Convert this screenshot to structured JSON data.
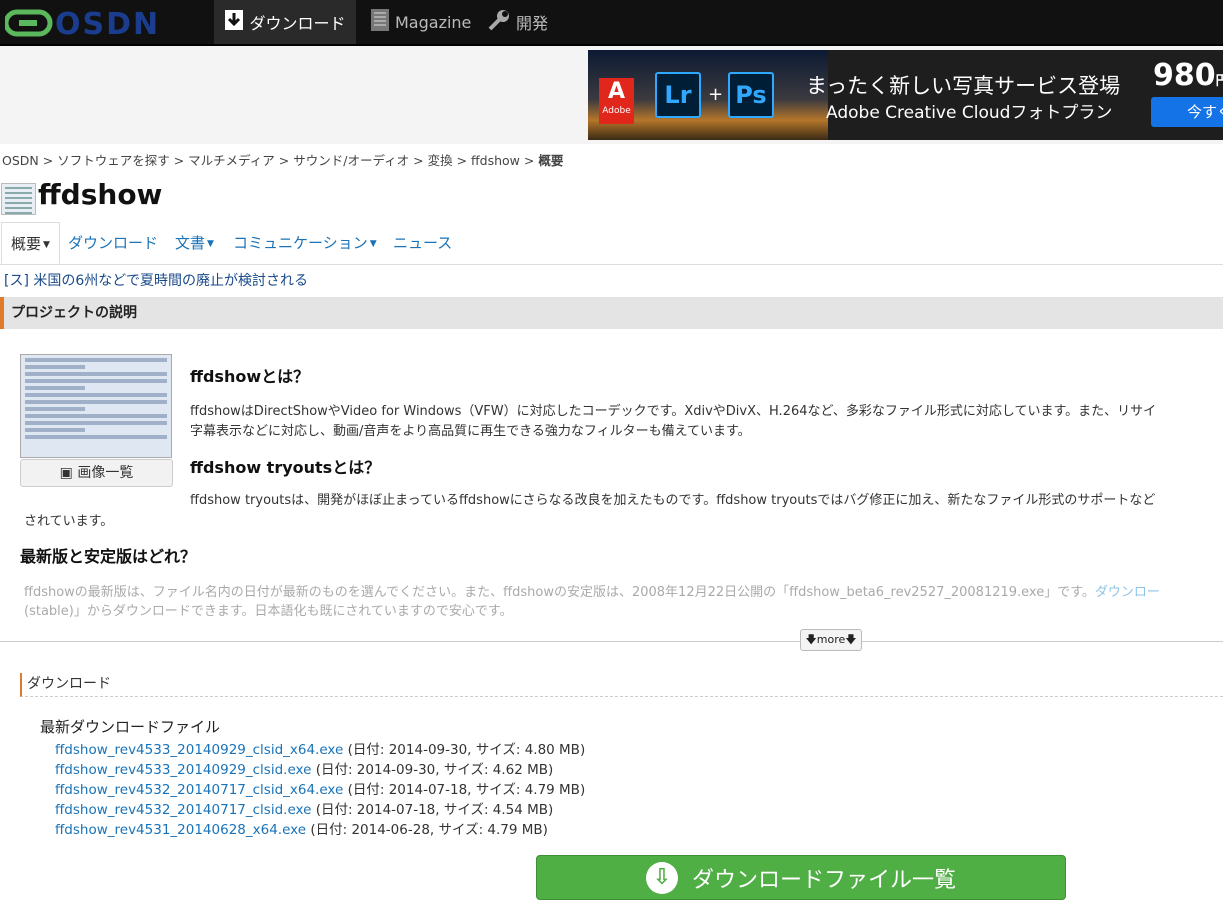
{
  "header": {
    "logo_text": "OSDN",
    "nav": [
      {
        "label": "ダウンロード",
        "icon": "download-icon",
        "active": true
      },
      {
        "label": "Magazine",
        "icon": "magazine-icon",
        "active": false
      },
      {
        "label": "開発",
        "icon": "wrench-icon",
        "active": false
      }
    ]
  },
  "ad": {
    "badge": "Adobe",
    "lr": "Lr",
    "plus": "+",
    "ps": "Ps",
    "line1": "まったく新しい写真サービス登場",
    "line2": "Adobe Creative Cloudフォトプラン",
    "price": "980",
    "price_unit": "円",
    "button": "今すぐ"
  },
  "breadcrumb": {
    "items": [
      "OSDN",
      "ソフトウェアを探す",
      "マルチメディア",
      "サウンド/オーディオ",
      "変換",
      "ffdshow"
    ],
    "current": "概要",
    "separator": ">"
  },
  "project": {
    "title": "ffdshow"
  },
  "tabs": [
    {
      "label": "概要",
      "caret": true
    },
    {
      "label": "ダウンロード",
      "caret": false
    },
    {
      "label": "文書",
      "caret": true
    },
    {
      "label": "コミュニケーション",
      "caret": true
    },
    {
      "label": "ニュース",
      "caret": false
    }
  ],
  "news_ticker": "[ス] 米国の6州などで夏時間の廃止が検討される",
  "description": {
    "section_title": "プロジェクトの説明",
    "gallery_button": "画像一覧",
    "h1": "ffdshowとは？",
    "p1_line1": "ffdshowはDirectShowやVideo for Windows（VFW）に対応したコーデックです。XdivやDivX、H.264など、多彩なファイル形式に対応しています。また、リサイ",
    "p1_line2": "字幕表示などに対応し、動画/音声をより高品質に再生できる強力なフィルターも備えています。",
    "h2": "ffdshow tryoutsとは？",
    "p2_line1": "ffdshow tryoutsは、開発がほぼ止まっているffdshowにさらなる改良を加えたものです。ffdshow tryoutsではバグ修正に加え、新たなファイル形式のサポートなど",
    "p2_line2": "されています。",
    "h3": "最新版と安定版はどれ？",
    "p3_line1": "ffdshowの最新版は、ファイル名内の日付が最新のものを選んでください。また、ffdshowの安定版は、2008年12月22日公開の「ffdshow_beta6_rev2527_20081219.exe」です。",
    "p3_link": "ダウンロー",
    "p3_line2": "(stable)」からダウンロードできます。日本語化も既にされていますので安心です。",
    "more": "more"
  },
  "downloads": {
    "section_title": "ダウンロード",
    "subtitle": "最新ダウンロードファイル",
    "files": [
      {
        "name": "ffdshow_rev4533_20140929_clsid_x64.exe",
        "meta": "(日付: 2014-09-30, サイズ: 4.80 MB)"
      },
      {
        "name": "ffdshow_rev4533_20140929_clsid.exe",
        "meta": "(日付: 2014-09-30, サイズ: 4.62 MB)"
      },
      {
        "name": "ffdshow_rev4532_20140717_clsid_x64.exe",
        "meta": "(日付: 2014-07-18, サイズ: 4.79 MB)"
      },
      {
        "name": "ffdshow_rev4532_20140717_clsid.exe",
        "meta": "(日付: 2014-07-18, サイズ: 4.54 MB)"
      },
      {
        "name": "ffdshow_rev4531_20140628_x64.exe",
        "meta": "(日付: 2014-06-28, サイズ: 4.79 MB)"
      }
    ],
    "button": "ダウンロードファイル一覧"
  },
  "colors": {
    "accent": "#e07b2c",
    "link": "#1a73b8",
    "button_green": "#4fae44"
  }
}
